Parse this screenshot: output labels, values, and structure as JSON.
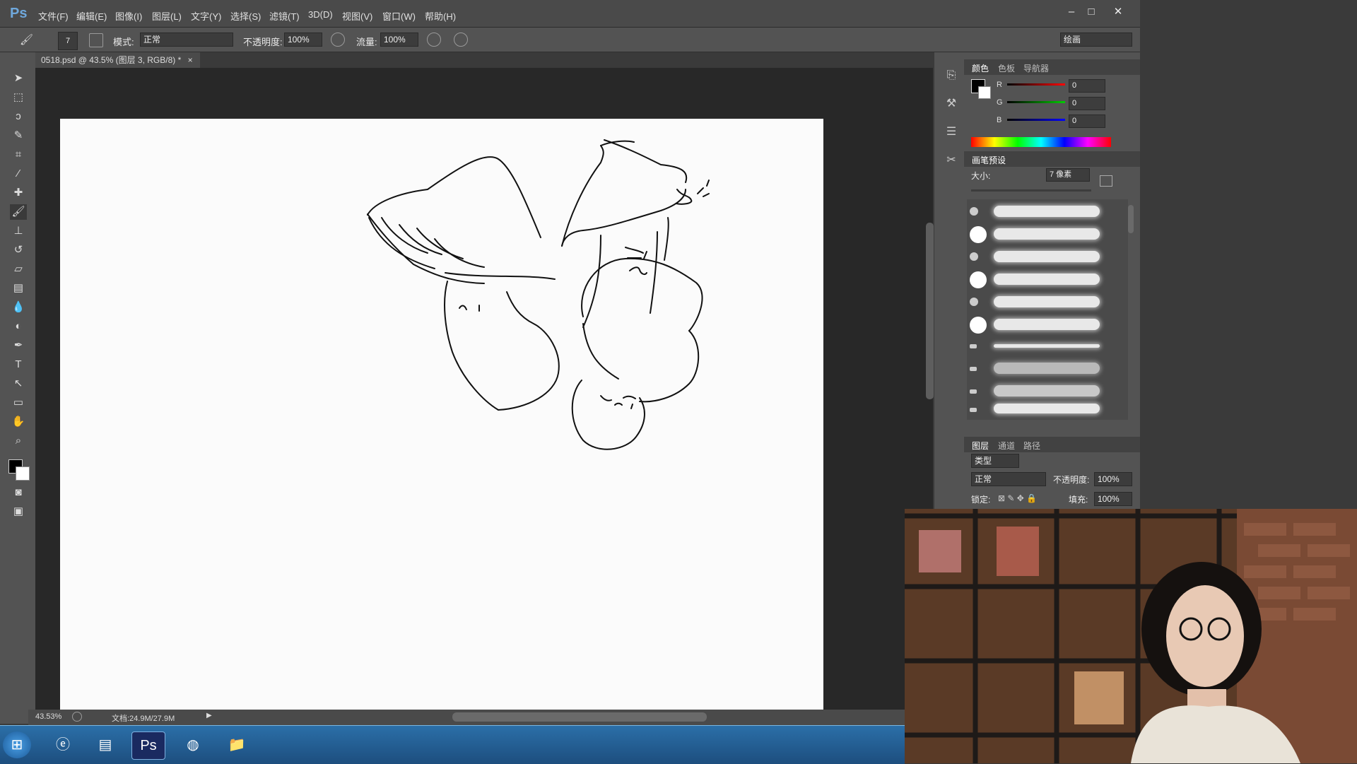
{
  "app": {
    "logo": "Ps",
    "menu": [
      "文件(F)",
      "编辑(E)",
      "图像(I)",
      "图层(L)",
      "文字(Y)",
      "选择(S)",
      "滤镜(T)",
      "3D(D)",
      "视图(V)",
      "窗口(W)",
      "帮助(H)"
    ],
    "window_controls": {
      "minimize": "–",
      "maximize": "□",
      "close": "✕"
    }
  },
  "options_bar": {
    "brush_size": "7",
    "mode_label": "模式:",
    "mode_value": "正常",
    "opacity_label": "不透明度:",
    "opacity_value": "100%",
    "flow_label": "流量:",
    "flow_value": "100%",
    "workspace": "绘画"
  },
  "document": {
    "tab_title": "0518.psd @ 43.5% (图层 3, RGB/8) *",
    "close": "×"
  },
  "status": {
    "zoom": "43.53%",
    "doc_size": "文档:24.9M/27.9M"
  },
  "color_panel": {
    "tabs": [
      "颜色",
      "色板",
      "导航器"
    ],
    "r_label": "R",
    "r_value": "0",
    "g_label": "G",
    "g_value": "0",
    "b_label": "B",
    "b_value": "0"
  },
  "brush_presets": {
    "title": "画笔预设",
    "size_label": "大小:",
    "size_value": "7 像素"
  },
  "layers_panel": {
    "tabs": [
      "图层",
      "通道",
      "路径"
    ],
    "filter_label": "类型",
    "blend_mode": "正常",
    "opacity_label": "不透明度:",
    "opacity_value": "100%",
    "lock_label": "锁定:",
    "fill_label": "填充:",
    "fill_value": "100%"
  },
  "icons": {
    "tools": [
      "move-icon",
      "marquee-icon",
      "lasso-icon",
      "quick-select-icon",
      "crop-icon",
      "eyedropper-icon",
      "healing-icon",
      "brush-icon",
      "stamp-icon",
      "history-brush-icon",
      "eraser-icon",
      "gradient-icon",
      "blur-icon",
      "dodge-icon",
      "pen-icon",
      "type-icon",
      "path-select-icon",
      "shape-icon",
      "hand-icon",
      "zoom-icon"
    ]
  },
  "colors": {
    "ui_dark": "#535353",
    "canvas": "#fbfbfb",
    "taskbar": "#1d4e7e"
  }
}
